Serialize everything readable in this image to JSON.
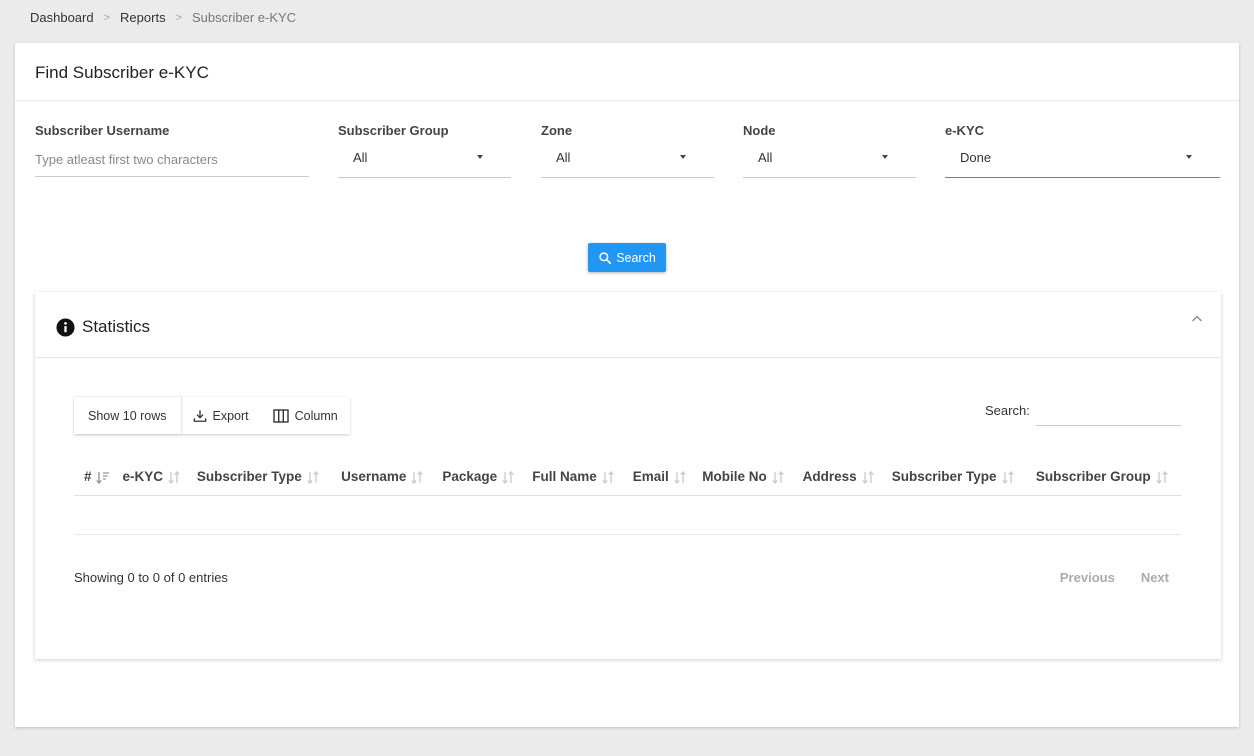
{
  "breadcrumb": [
    "Dashboard",
    "Reports",
    "Subscriber e-KYC"
  ],
  "breadcrumb_separator": ">",
  "page_title": "Find Subscriber e-KYC",
  "filters": {
    "username": {
      "label": "Subscriber Username",
      "placeholder": "Type atleast first two characters"
    },
    "group": {
      "label": "Subscriber Group",
      "value": "All"
    },
    "zone": {
      "label": "Zone",
      "value": "All"
    },
    "node": {
      "label": "Node",
      "value": "All"
    },
    "ekyc": {
      "label": "e-KYC",
      "value": "Done"
    }
  },
  "search_button": "Search",
  "statistics": {
    "title": "Statistics",
    "toolbar": {
      "show_rows": "Show 10 rows",
      "export": "Export",
      "column": "Column"
    },
    "search_label": "Search:",
    "columns": [
      "#",
      "e-KYC",
      "Subscriber Type",
      "Username",
      "Package",
      "Full Name",
      "Email",
      "Mobile No",
      "Address",
      "Subscriber Type",
      "Subscriber Group"
    ],
    "info": "Showing 0 to 0 of 0 entries",
    "pager": {
      "previous": "Previous",
      "next": "Next"
    }
  },
  "colors": {
    "accent": "#2196f3",
    "background": "#ebebeb"
  },
  "icons": [
    "search-icon",
    "info-icon",
    "chevron-up-icon",
    "download-icon",
    "columns-icon",
    "sort-icon"
  ]
}
